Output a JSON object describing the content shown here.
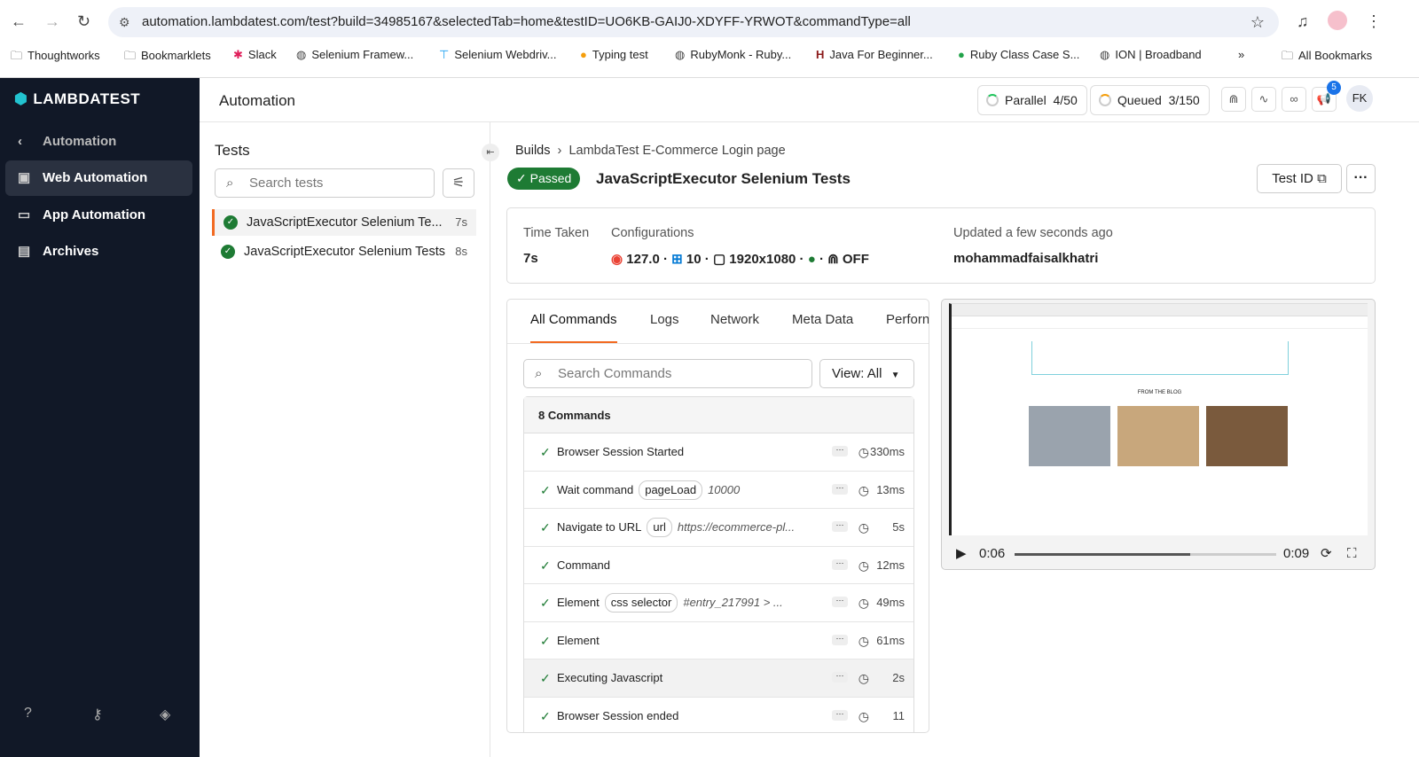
{
  "browser": {
    "url": "automation.lambdatest.com/test?build=34985167&selectedTab=home&testID=UO6KB-GAIJ0-XDYFF-YRWOT&commandType=all",
    "bookmarks": [
      "Thoughtworks",
      "Bookmarklets",
      "Slack",
      "Selenium Framew...",
      "Selenium Webdriv...",
      "Typing test",
      "RubyMonk - Ruby...",
      "Java For Beginner...",
      "Ruby Class Case S...",
      "ION | Broadband"
    ],
    "all_bookmarks": "All Bookmarks"
  },
  "sidebar": {
    "logo": "LAMBDATEST",
    "back": "Automation",
    "items": [
      {
        "label": "Web Automation",
        "active": true
      },
      {
        "label": "App Automation"
      },
      {
        "label": "Archives"
      }
    ]
  },
  "header": {
    "title": "Automation",
    "parallel_label": "Parallel",
    "parallel": "4/50",
    "queued_label": "Queued",
    "queued": "3/150",
    "notifications": "5",
    "avatar": "FK"
  },
  "tests": {
    "title": "Tests",
    "search_placeholder": "Search tests",
    "items": [
      {
        "name": "JavaScriptExecutor Selenium Te...",
        "duration": "7s"
      },
      {
        "name": "JavaScriptExecutor Selenium Tests",
        "duration": "8s"
      }
    ]
  },
  "detail": {
    "breadcrumb": [
      "Builds",
      "LambdaTest E-Commerce Login page"
    ],
    "status": "Passed",
    "title": "JavaScriptExecutor Selenium Tests",
    "test_id_label": "Test ID",
    "time_taken_label": "Time Taken",
    "time_taken": "7s",
    "config_label": "Configurations",
    "browser_version": "127.0",
    "os_version": "10",
    "resolution": "1920x1080",
    "tunnel": "OFF",
    "updated_label": "Updated a few seconds ago",
    "user": "mohammadfaisalkhatri"
  },
  "commands": {
    "tabs": [
      "All Commands",
      "Logs",
      "Network",
      "Meta Data",
      "Perforn"
    ],
    "search_placeholder": "Search Commands",
    "view": "View: All",
    "count": "8 Commands",
    "rows": [
      {
        "name": "Browser Session Started",
        "time": "330ms"
      },
      {
        "name": "Wait command",
        "tag": "pageLoad",
        "arg": "10000",
        "time": "13ms"
      },
      {
        "name": "Navigate to URL",
        "tag": "url",
        "arg": "https://ecommerce-pl...",
        "time": "5s"
      },
      {
        "name": "Command",
        "time": "12ms"
      },
      {
        "name": "Element",
        "tag": "css selector",
        "arg": "#entry_217991 > ...",
        "time": "49ms"
      },
      {
        "name": "Element",
        "time": "61ms"
      },
      {
        "name": "Executing Javascript",
        "time": "2s"
      },
      {
        "name": "Browser Session ended",
        "time": "11"
      }
    ]
  },
  "video": {
    "current": "0:06",
    "total": "0:09",
    "progress": 0.67,
    "blog_heading": "FROM THE BLOG"
  },
  "colors": {
    "accent": "#f26a21",
    "passed": "#1e7b34",
    "sidebar": "#111827"
  }
}
